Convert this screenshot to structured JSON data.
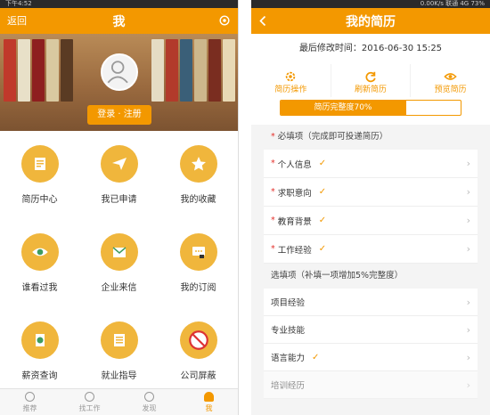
{
  "left": {
    "status": {
      "time": "下午4:52",
      "right": ""
    },
    "header": {
      "back_label": "返回",
      "title": "我"
    },
    "banner": {
      "login_label": "登录 · 注册"
    },
    "grid": [
      {
        "label": "简历中心",
        "icon": "resume-icon"
      },
      {
        "label": "我已申请",
        "icon": "paper-plane-icon"
      },
      {
        "label": "我的收藏",
        "icon": "star-icon"
      },
      {
        "label": "谁看过我",
        "icon": "eye-icon"
      },
      {
        "label": "企业来信",
        "icon": "mail-icon"
      },
      {
        "label": "我的订阅",
        "icon": "subscribe-icon"
      },
      {
        "label": "薪资查询",
        "icon": "salary-icon"
      },
      {
        "label": "就业指导",
        "icon": "guide-icon"
      },
      {
        "label": "公司屏蔽",
        "icon": "block-hr-icon"
      }
    ],
    "tabs": [
      {
        "label": "推荐",
        "active": false
      },
      {
        "label": "找工作",
        "active": false
      },
      {
        "label": "发现",
        "active": false
      },
      {
        "label": "我",
        "active": true
      }
    ]
  },
  "right": {
    "status": {
      "time": "",
      "right": "0.00K/s 联通 4G 73%"
    },
    "header": {
      "back_icon": "chevron-left-icon",
      "title": "我的简历"
    },
    "modified": "最后修改时间：2016-06-30 15:25",
    "actions": [
      {
        "label": "简历操作",
        "icon": "gear-icon"
      },
      {
        "label": "刷新简历",
        "icon": "refresh-icon"
      },
      {
        "label": "预览简历",
        "icon": "eye-icon"
      }
    ],
    "completeness": {
      "label": "简历完整度70%",
      "value": 70
    },
    "required_title": "必填项（完成即可投递简历）",
    "required_items": [
      {
        "label": "个人信息"
      },
      {
        "label": "求职意向"
      },
      {
        "label": "教育背景"
      },
      {
        "label": "工作经验"
      }
    ],
    "optional_title": "选填项（补填一项增加5%完整度）",
    "optional_items": [
      {
        "label": "项目经验",
        "done": false
      },
      {
        "label": "专业技能",
        "done": false
      },
      {
        "label": "语言能力",
        "done": true
      },
      {
        "label": "培训经历",
        "done": false
      }
    ],
    "colors": {
      "accent": "#f39800",
      "required_star": "#e5322d"
    }
  }
}
